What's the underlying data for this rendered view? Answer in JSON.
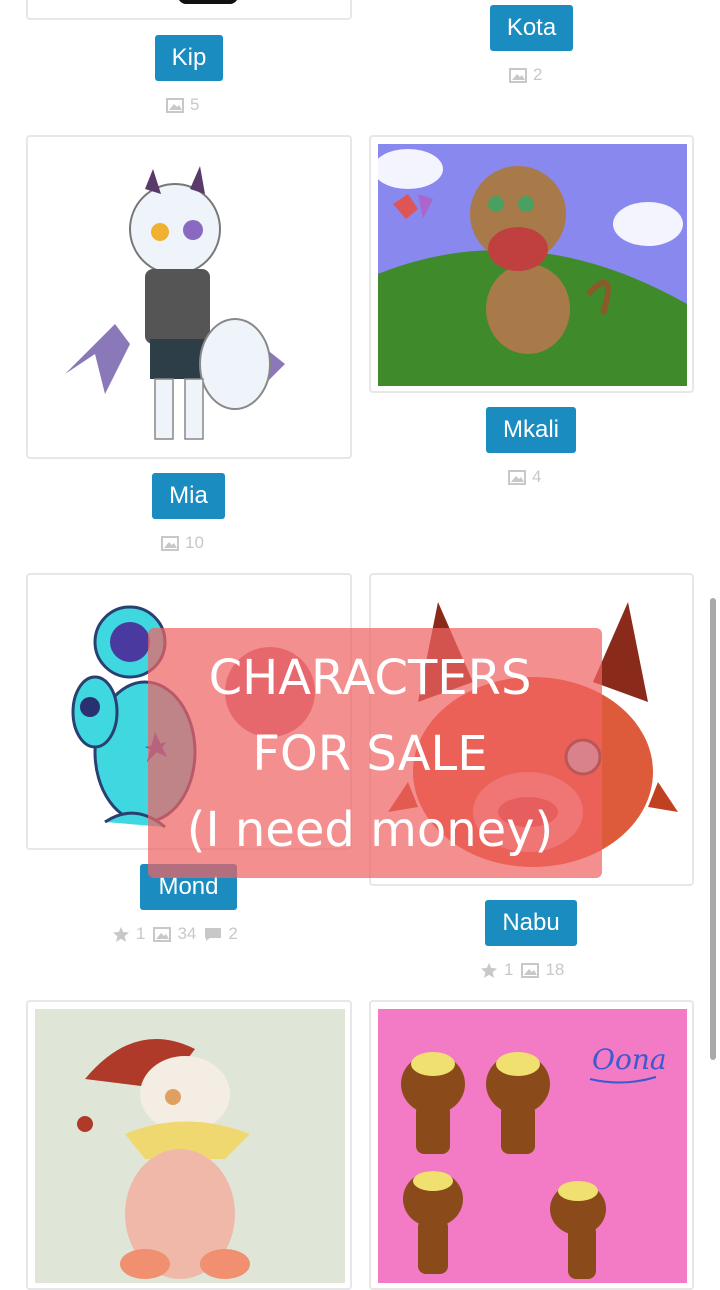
{
  "characters": [
    {
      "name": "Kip",
      "stats": {
        "images": "5"
      }
    },
    {
      "name": "Kota",
      "stats": {
        "images": "2"
      }
    },
    {
      "name": "Mia",
      "stats": {
        "images": "10"
      }
    },
    {
      "name": "Mkali",
      "stats": {
        "images": "4"
      }
    },
    {
      "name": "Mond",
      "stats": {
        "favorites": "1",
        "images": "34",
        "comments": "2"
      }
    },
    {
      "name": "Nabu",
      "stats": {
        "favorites": "1",
        "images": "18"
      }
    },
    {
      "name": ""
    },
    {
      "name": ""
    }
  ],
  "overlay": {
    "line1": "CHARACTERS",
    "line2": "FOR SALE",
    "line3": "(I need money)"
  },
  "art_text": {
    "oona_signature": "Oona"
  },
  "colors": {
    "button_bg": "#1a8cc0",
    "overlay_bg": "#f06464",
    "stat_gray": "#c8c8c8"
  },
  "icons": {
    "image_count": "image-icon",
    "favorites": "star-icon",
    "comments": "comment-icon"
  }
}
